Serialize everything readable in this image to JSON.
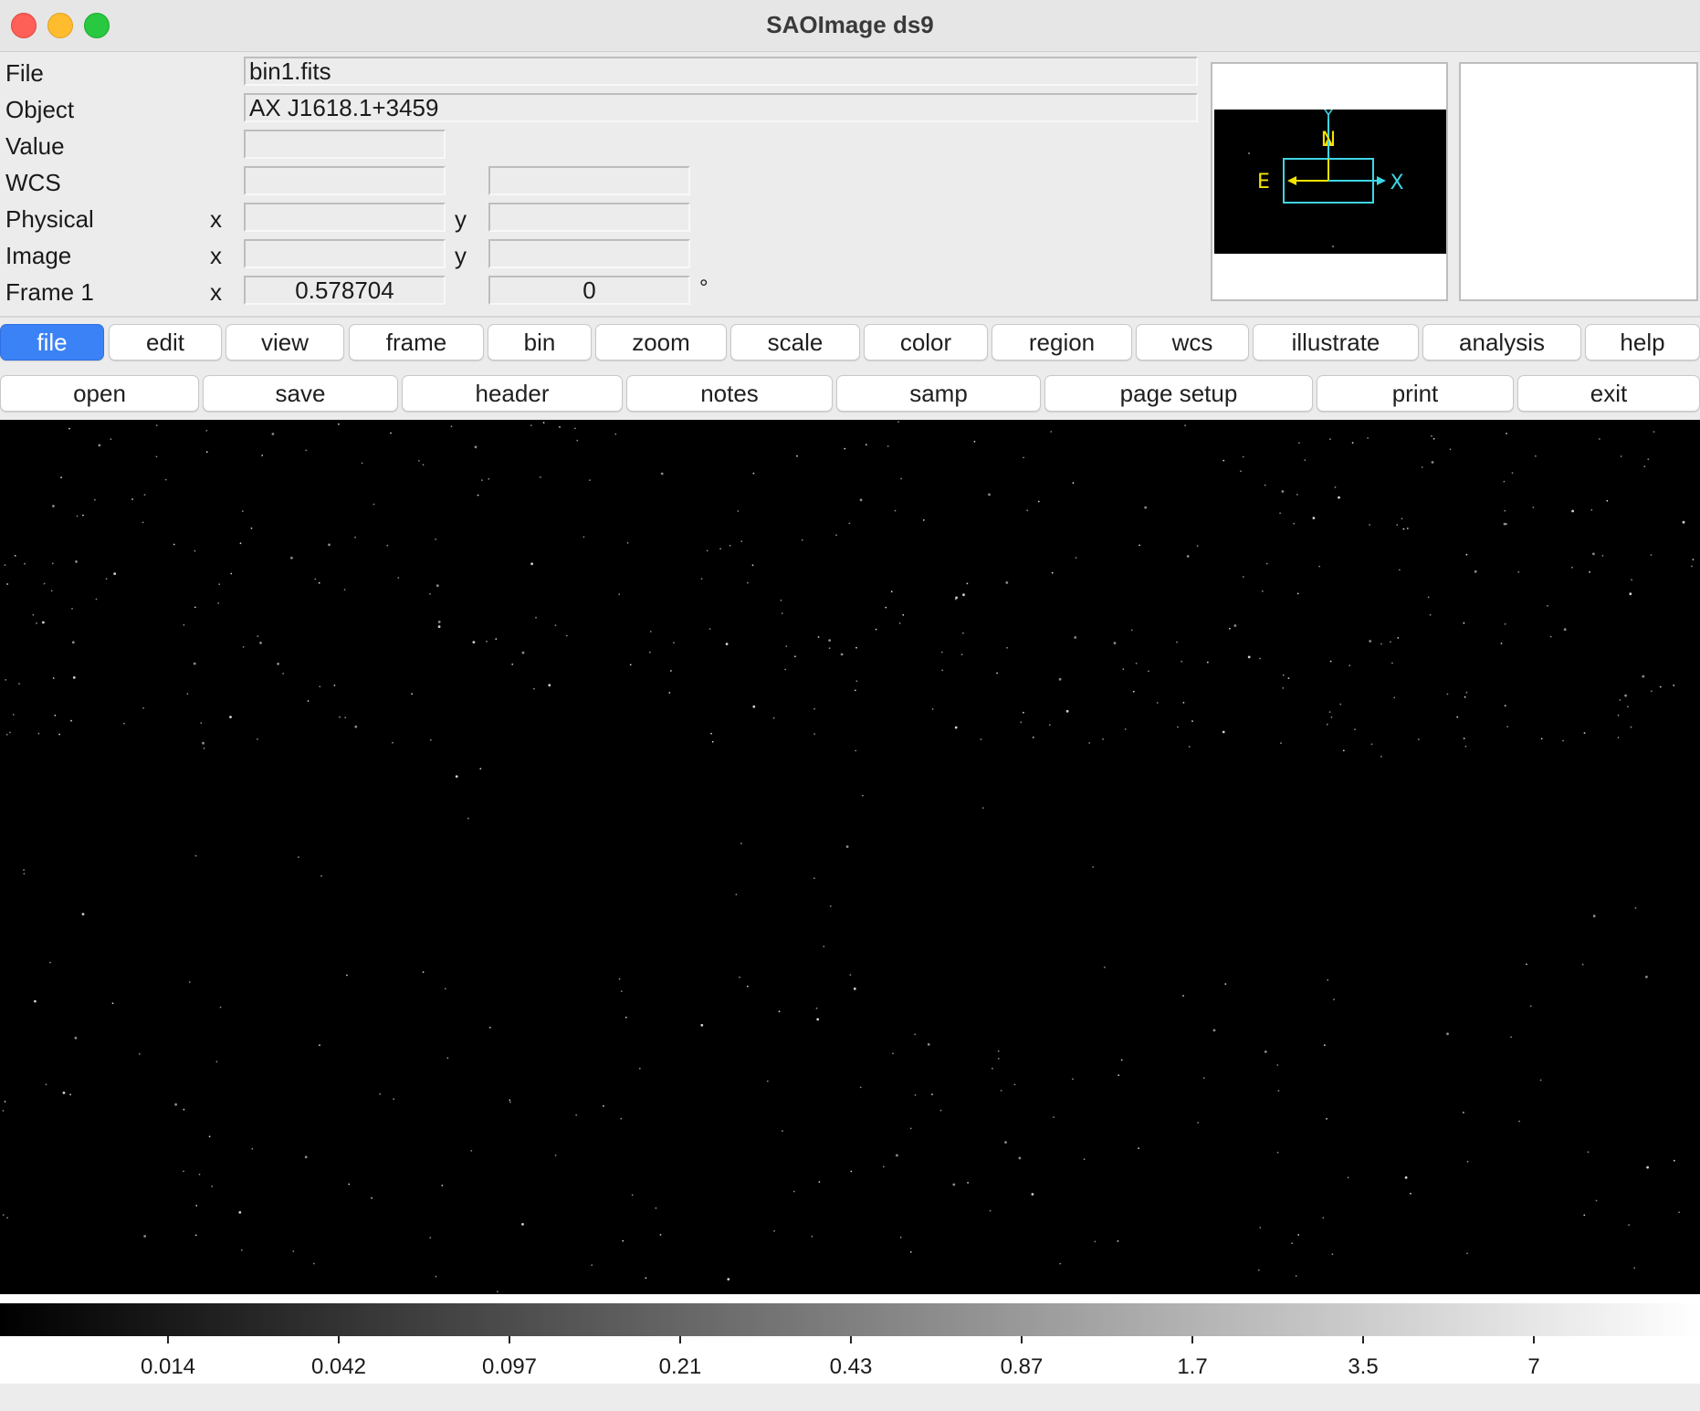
{
  "window": {
    "title": "SAOImage ds9"
  },
  "info": {
    "file_label": "File",
    "file_value": "bin1.fits",
    "object_label": "Object",
    "object_value": "AX J1618.1+3459",
    "value_label": "Value",
    "value_value": "",
    "wcs_label": "WCS",
    "wcs_value1": "",
    "wcs_value2": "",
    "physical_label": "Physical",
    "physical_x": "",
    "physical_y": "",
    "image_label": "Image",
    "image_x": "",
    "image_y": "",
    "frame_label": "Frame 1",
    "frame_zoom": "0.578704",
    "frame_angle": "0",
    "x_label": "x",
    "y_label": "y",
    "degree": "°"
  },
  "panner": {
    "north": "N",
    "east": "E",
    "x_axis": "X",
    "y_axis": "Y"
  },
  "menu": [
    "file",
    "edit",
    "view",
    "frame",
    "bin",
    "zoom",
    "scale",
    "color",
    "region",
    "wcs",
    "illustrate",
    "analysis",
    "help"
  ],
  "menu_active": "file",
  "file_buttons": [
    "open",
    "save",
    "header",
    "notes",
    "samp",
    "page setup",
    "print",
    "exit"
  ],
  "colorbar": {
    "ticks": [
      "0.014",
      "0.042",
      "0.097",
      "0.21",
      "0.43",
      "0.87",
      "1.7",
      "3.5",
      "7"
    ]
  },
  "colors": {
    "active_button": "#3b82f6",
    "compass_yellow": "#f5e400",
    "compass_cyan": "#3fd6e6"
  }
}
